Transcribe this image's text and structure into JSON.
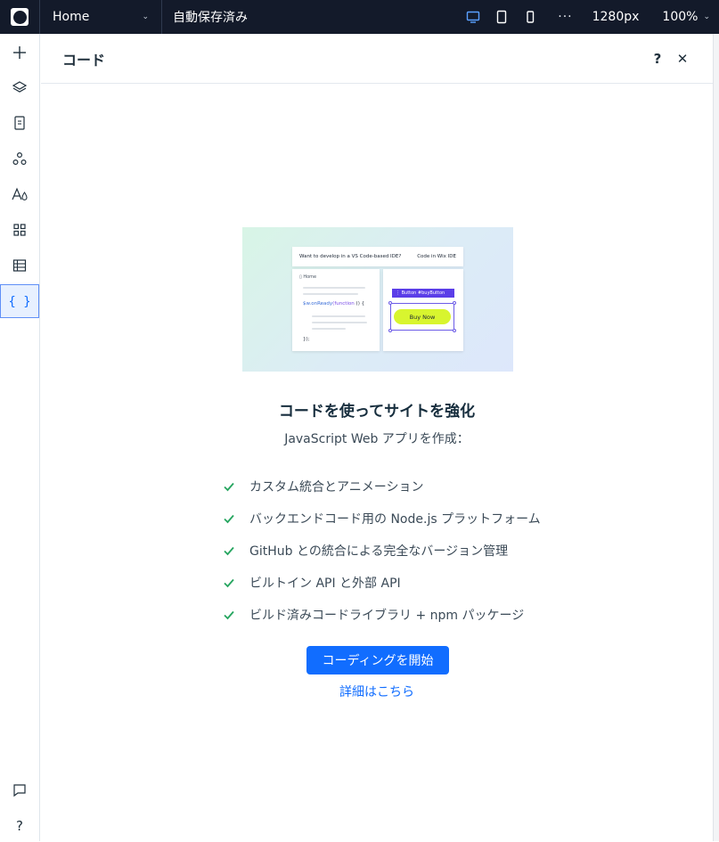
{
  "topbar": {
    "page_name": "Home",
    "autosave_status": "自動保存済み",
    "width_value": "1280px",
    "zoom_value": "100%",
    "more_label": "···"
  },
  "rail": {
    "icons": [
      "plus-icon",
      "layers-icon",
      "page-icon",
      "apps-icon",
      "theme-icon",
      "widgets-icon",
      "table-icon",
      "code-icon",
      "chat-icon",
      "help-icon"
    ],
    "active": "code-icon"
  },
  "panel": {
    "title": "コード",
    "help_label": "?",
    "close_label": "✕"
  },
  "hero": {
    "top_text": "Want to develop in a VS Code-based IDE?",
    "top_action": "Code in Wix IDE",
    "home_label": "Home",
    "code_line_prefix": "$w.onReady",
    "code_line_func": "(function",
    "code_line_suffix": " () {",
    "code_end": "});",
    "tag_label": "⋮ Button #buyButton",
    "button_label": "Buy Now"
  },
  "content": {
    "heading": "コードを使ってサイトを強化",
    "subheading": "JavaScript Web アプリを作成：",
    "features": [
      "カスタム統合とアニメーション",
      "バックエンドコード用の Node.js プラットフォーム",
      "GitHub との統合による完全なバージョン管理",
      "ビルトイン API と外部 API",
      "ビルド済みコードライブラリ + npm パッケージ"
    ],
    "cta_label": "コーディングを開始",
    "learn_more": "詳細はこちら"
  },
  "colors": {
    "topbar_bg": "#131a2a",
    "accent": "#116dff",
    "check": "#25a55f"
  }
}
